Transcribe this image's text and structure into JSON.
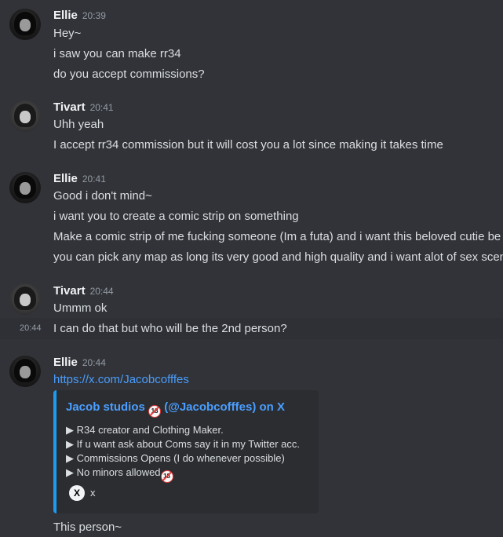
{
  "messages": {
    "g1": {
      "author": "Ellie",
      "time": "20:39",
      "lines": [
        "Hey~",
        "i saw you can make rr34",
        "do you accept commissions?"
      ]
    },
    "g2": {
      "author": "Tivart",
      "time": "20:41",
      "lines": [
        "Uhh yeah",
        "I accept rr34 commission but it will cost you a lot since making it takes time"
      ]
    },
    "g3": {
      "author": "Ellie",
      "time": "20:41",
      "lines": [
        "Good i don't mind~",
        "i want you to create a comic strip on something",
        "Make a comic strip of me fucking someone (Im a futa) and i want this beloved cutie be",
        "you can pick any map as long its very good and high quality and i want alot of sex scen"
      ]
    },
    "g4": {
      "author": "Tivart",
      "time": "20:44",
      "lines": [
        "Ummm ok",
        "I can do that but who will be the 2nd person?"
      ],
      "hover_time": "20:44"
    },
    "g5": {
      "author": "Ellie",
      "time": "20:44",
      "link": "https://x.com/Jacobcofffes",
      "after": "This person~"
    }
  },
  "embed": {
    "title_left": "Jacob studios",
    "title_right": "(@Jacobcofffes) on X",
    "desc": [
      "▶ R34 creator and Clothing Maker.",
      "▶ If u want ask about Coms say it in my Twitter acc.",
      "▶ Commissions Opens (I do whenever possible)",
      "▶ No minors allowed"
    ],
    "badge": "18",
    "footer_icon": "X",
    "footer": "x"
  },
  "colors": {
    "background": "#313338",
    "text": "#dbdee1",
    "link": "#4a9eff",
    "embed_border": "#1d9bf0"
  }
}
